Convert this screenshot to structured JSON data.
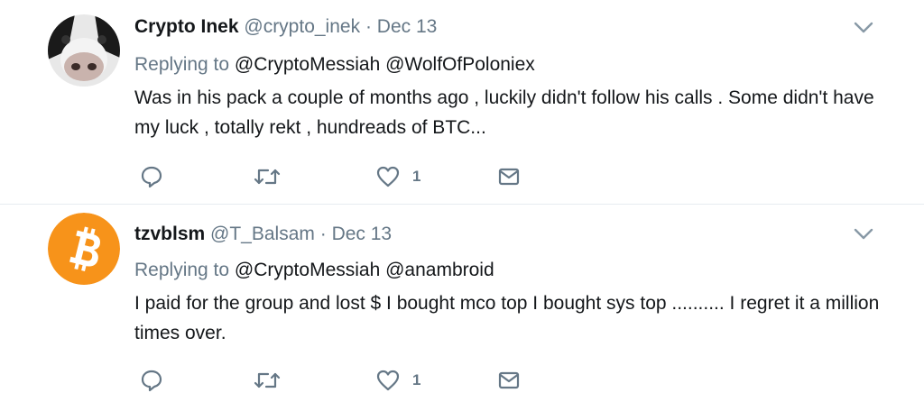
{
  "tweets": [
    {
      "name": "Crypto Inek",
      "handle": "@crypto_inek",
      "separator": "·",
      "date": "Dec 13",
      "replying_prefix": "Replying to",
      "replying_to": "@CryptoMessiah @WolfOfPoloniex",
      "text": "Was in his pack a couple of months ago , luckily didn't follow his calls . Some didn't have my luck , totally rekt , hundreads of BTC...",
      "like_count": "1",
      "avatar_icon": "cow-avatar-icon"
    },
    {
      "name": "tzvblsm",
      "handle": "@T_Balsam",
      "separator": "·",
      "date": "Dec 13",
      "replying_prefix": "Replying to",
      "replying_to": "@CryptoMessiah @anambroid",
      "text": "I paid for the group and lost $ I bought mco top I bought sys top .......... I regret it a million times over.",
      "like_count": "1",
      "avatar_icon": "bitcoin-avatar-icon"
    }
  ],
  "colors": {
    "text": "#14171a",
    "secondary": "#657786",
    "divider": "#e6ecf0",
    "bitcoin_orange": "#f7931a"
  }
}
